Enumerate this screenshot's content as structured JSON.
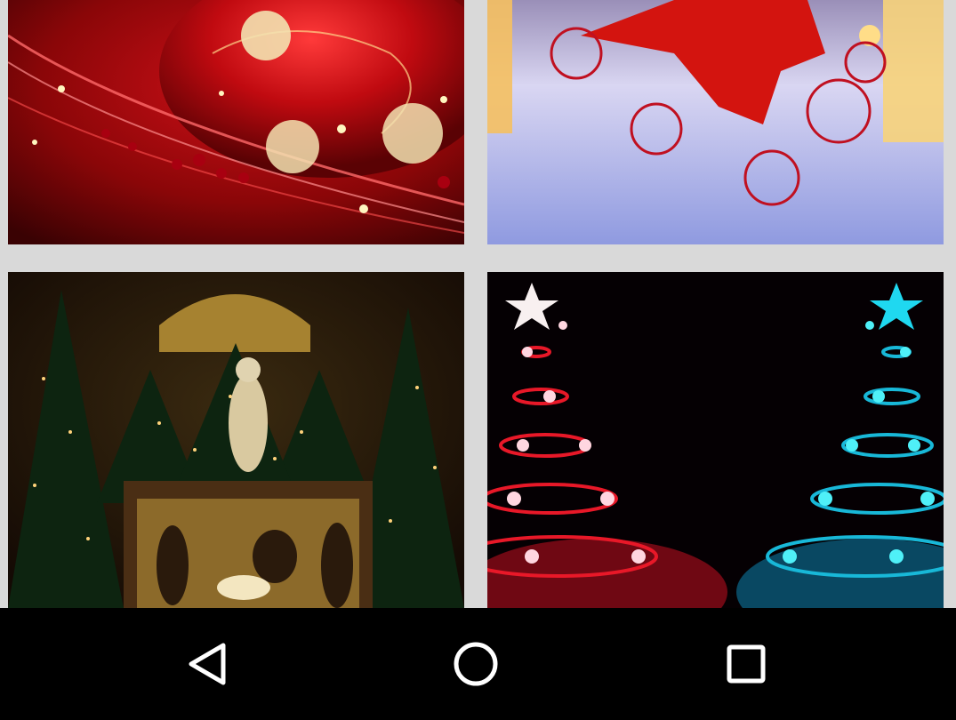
{
  "gallery": {
    "tiles": [
      {
        "icon": "red-christmas-ornament-image"
      },
      {
        "icon": "red-star-snow-image"
      },
      {
        "icon": "nativity-scene-image"
      },
      {
        "icon": "spiral-christmas-trees-image"
      }
    ]
  },
  "navbar": {
    "back": {
      "icon": "back-triangle-icon"
    },
    "home": {
      "icon": "home-circle-icon"
    },
    "recents": {
      "icon": "recents-square-icon"
    }
  },
  "colors": {
    "navbar_bg": "#000000",
    "gallery_bg": "#d9d9d9",
    "nav_icon": "#ffffff"
  }
}
